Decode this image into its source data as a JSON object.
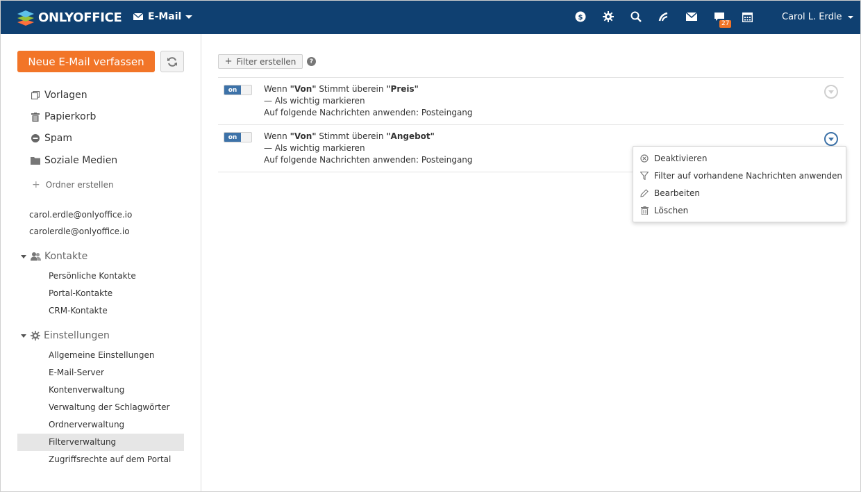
{
  "header": {
    "logo_text": "ONLYOFFICE",
    "module_label": "E-Mail",
    "user_name": "Carol L. Erdle",
    "chat_badge": "27",
    "icons": [
      "payments-icon",
      "settings-icon",
      "search-icon",
      "feed-icon",
      "mail-icon",
      "chat-icon",
      "calendar-icon"
    ],
    "accent": "#0f4071"
  },
  "sidebar": {
    "compose_label": "Neue E-Mail verfassen",
    "compose_color": "#f27528",
    "folders": [
      {
        "label": "Vorlagen",
        "icon": "templates-icon"
      },
      {
        "label": "Papierkorb",
        "icon": "trash-icon"
      },
      {
        "label": "Spam",
        "icon": "spam-icon"
      },
      {
        "label": "Soziale Medien",
        "icon": "folder-icon"
      }
    ],
    "create_folder_label": "Ordner erstellen",
    "accounts": [
      "carol.erdle@onlyoffice.io",
      "carolerdle@onlyoffice.io"
    ],
    "contacts": {
      "title": "Kontakte",
      "items": [
        "Persönliche Kontakte",
        "Portal-Kontakte",
        "CRM-Kontakte"
      ]
    },
    "settings": {
      "title": "Einstellungen",
      "items": [
        "Allgemeine Einstellungen",
        "E-Mail-Server",
        "Kontenverwaltung",
        "Verwaltung der Schlagwörter",
        "Ordnerverwaltung",
        "Filterverwaltung",
        "Zugriffsrechte auf dem Portal"
      ],
      "active": "Filterverwaltung"
    }
  },
  "main": {
    "create_filter_label": "Filter erstellen",
    "help_symbol": "?",
    "filters": [
      {
        "toggle_label": "on",
        "prefix": "Wenn ",
        "field": "\"Von\"",
        "operator": " Stimmt überein ",
        "value": "\"Preis\"",
        "action": "— Als wichtig markieren",
        "apply_to": "Auf folgende Nachrichten anwenden: Posteingang"
      },
      {
        "toggle_label": "on",
        "prefix": "Wenn ",
        "field": "\"Von\"",
        "operator": " Stimmt überein ",
        "value": "\"Angebot\"",
        "action": "— Als wichtig markieren",
        "apply_to": "Auf folgende Nachrichten anwenden: Posteingang"
      }
    ],
    "menu": [
      {
        "label": "Deaktivieren",
        "icon": "deactivate-icon"
      },
      {
        "label": "Filter auf vorhandene Nachrichten anwenden",
        "icon": "filter-icon"
      },
      {
        "label": "Bearbeiten",
        "icon": "edit-icon"
      },
      {
        "label": "Löschen",
        "icon": "delete-icon"
      }
    ]
  }
}
